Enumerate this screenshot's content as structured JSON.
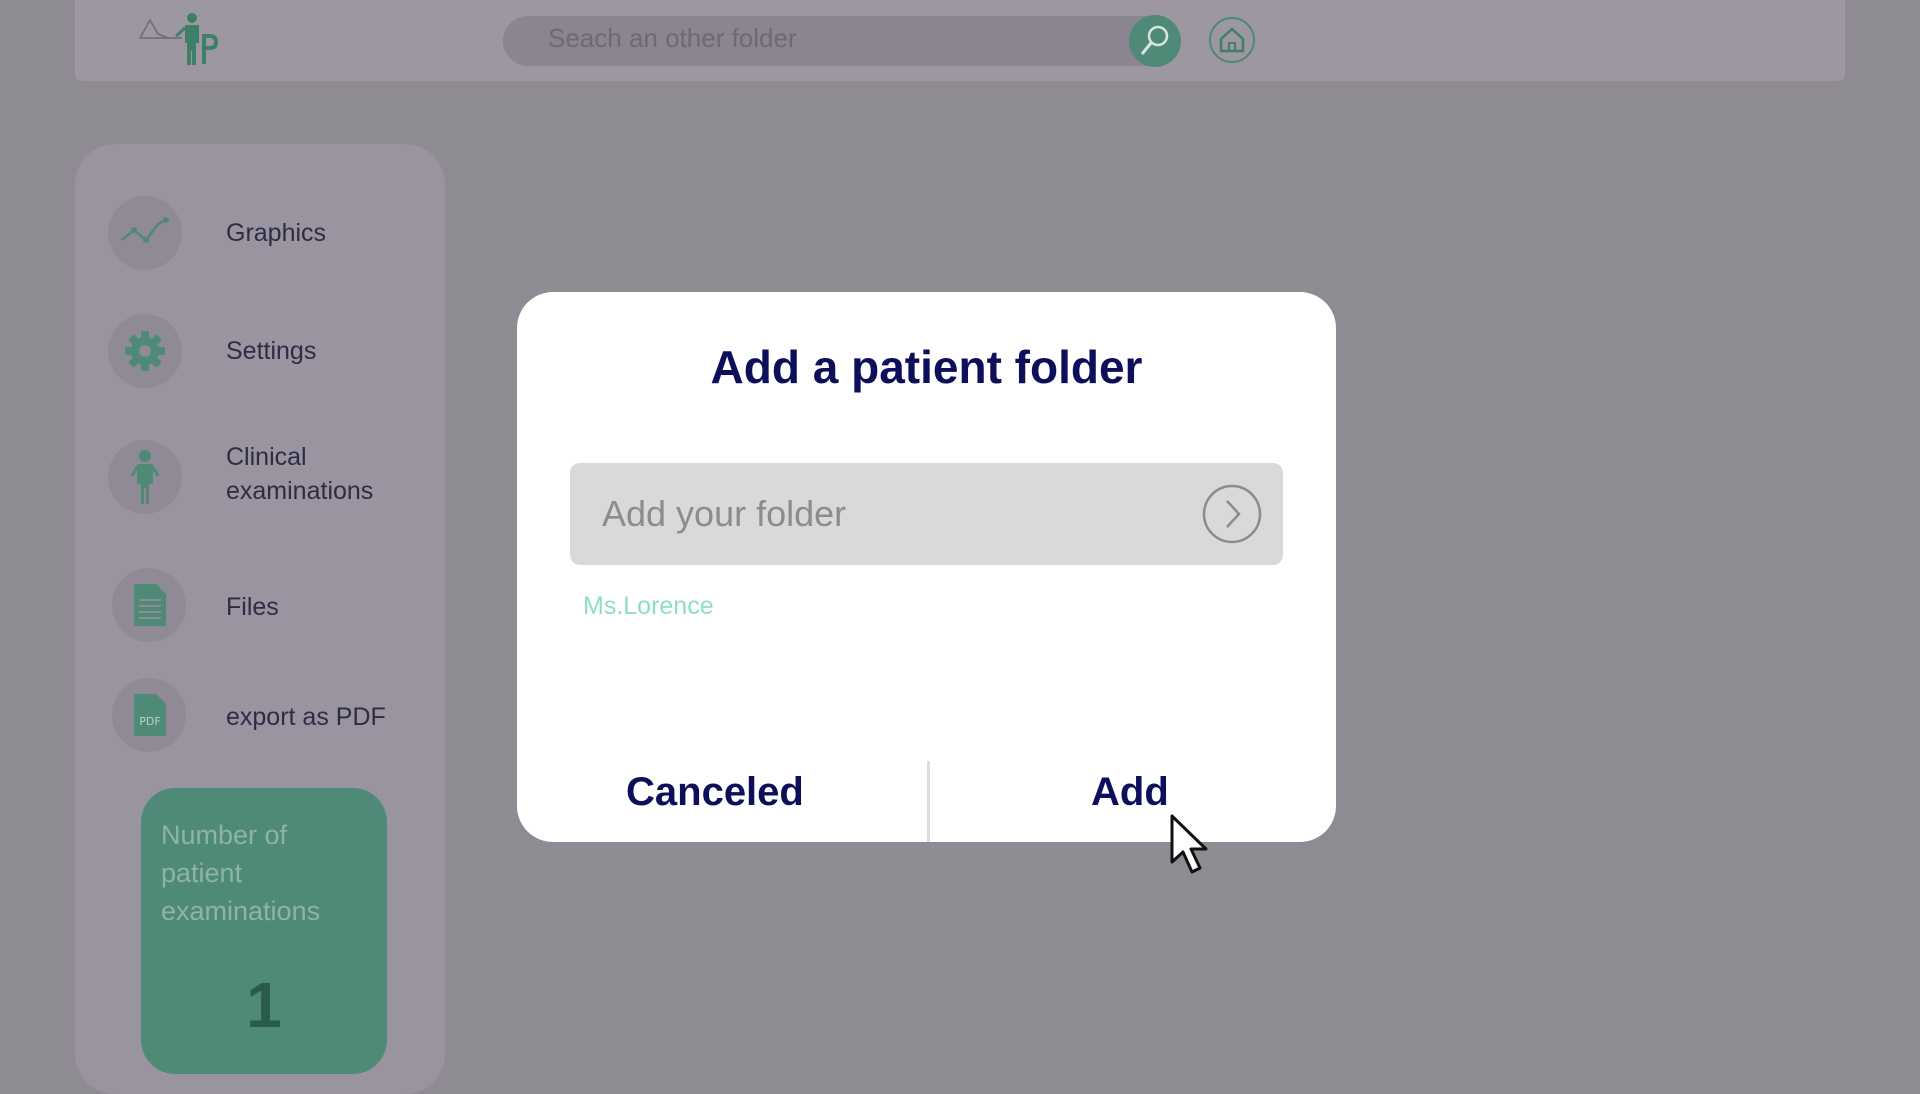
{
  "header": {
    "logo_icon": "doctor-logo-icon",
    "search_placeholder": "Seach an other folder",
    "search_button_icon": "search-icon",
    "home_button_icon": "home-icon"
  },
  "sidebar": {
    "items": [
      {
        "label": "Graphics",
        "icon": "line-chart-icon"
      },
      {
        "label": "Settings",
        "icon": "gear-icon"
      },
      {
        "label": "Clinical examinations",
        "icon": "person-icon"
      },
      {
        "label": "Files",
        "icon": "document-icon"
      },
      {
        "label": "export as PDF",
        "icon": "pdf-icon"
      }
    ],
    "counter": {
      "label": "Number of patient examinations",
      "value": "1"
    }
  },
  "modal": {
    "title": "Add a patient folder",
    "input_placeholder": "Add your folder",
    "suggestion": "Ms.Lorence",
    "cancel_label": "Canceled",
    "add_label": "Add"
  },
  "colors": {
    "accent": "#4f8a78",
    "title": "#0d0f5b",
    "suggestion": "#8fdcc8",
    "overlay": "#8e8b92"
  }
}
